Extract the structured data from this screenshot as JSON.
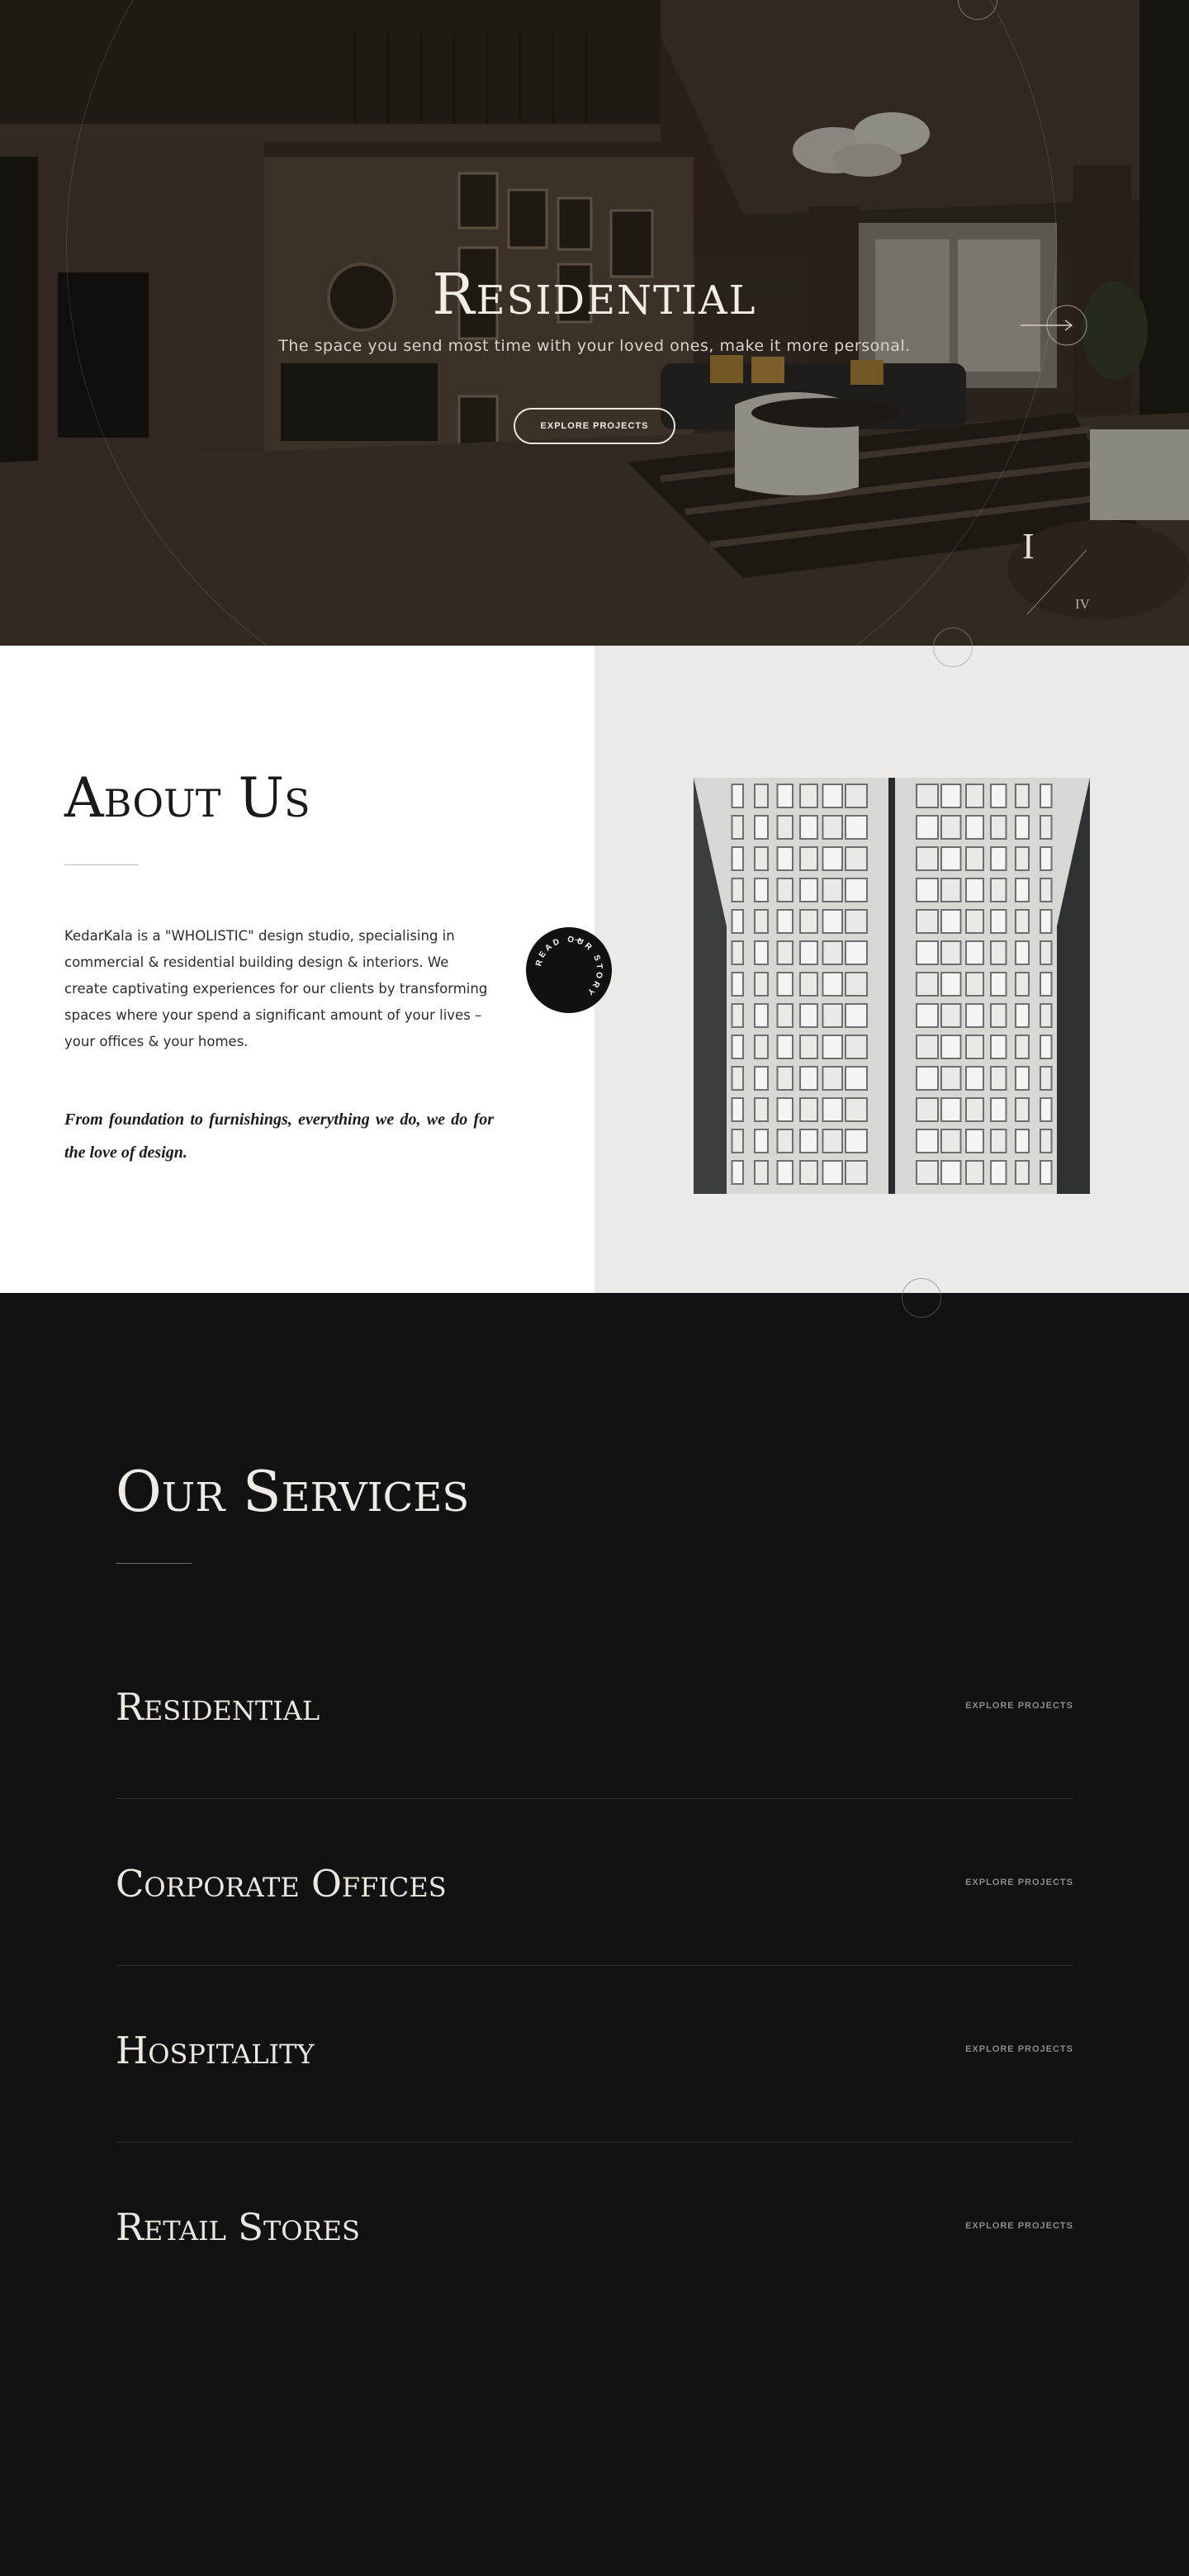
{
  "hero": {
    "title": "Residential",
    "subtitle": "The space you send most time with your loved ones, make it more personal.",
    "button_label": "EXPLORE PROJECTS",
    "slide_current": "I",
    "slide_total": "IV"
  },
  "about": {
    "title": "About Us",
    "body": "KedarKala is a \"WHOLISTIC\" design studio, specialising in commercial & residential building design & interiors. We create captivating experiences for our clients by transforming spaces where your spend a significant amount of your lives – your offices & your homes.",
    "quote": "From foundation to furnishings, everything we do, we do for the love of design.",
    "badge_text": "READ OUR STORY",
    "badge_arrow": "→"
  },
  "services": {
    "title": "Our Services",
    "items": [
      {
        "name": "Residential",
        "link": "EXPLORE PROJECTS"
      },
      {
        "name": "Corporate Offices",
        "link": "EXPLORE PROJECTS"
      },
      {
        "name": "Hospitality",
        "link": "EXPLORE PROJECTS"
      },
      {
        "name": "Retail Stores",
        "link": "EXPLORE PROJECTS"
      }
    ]
  },
  "colors": {
    "dark_bg": "#121212",
    "about_panel": "#ebeae6",
    "light_text": "#f0ece5",
    "muted_link": "#8c8c8c"
  },
  "icons": [
    "arrow-right-icon",
    "badge-arrow-icon"
  ]
}
